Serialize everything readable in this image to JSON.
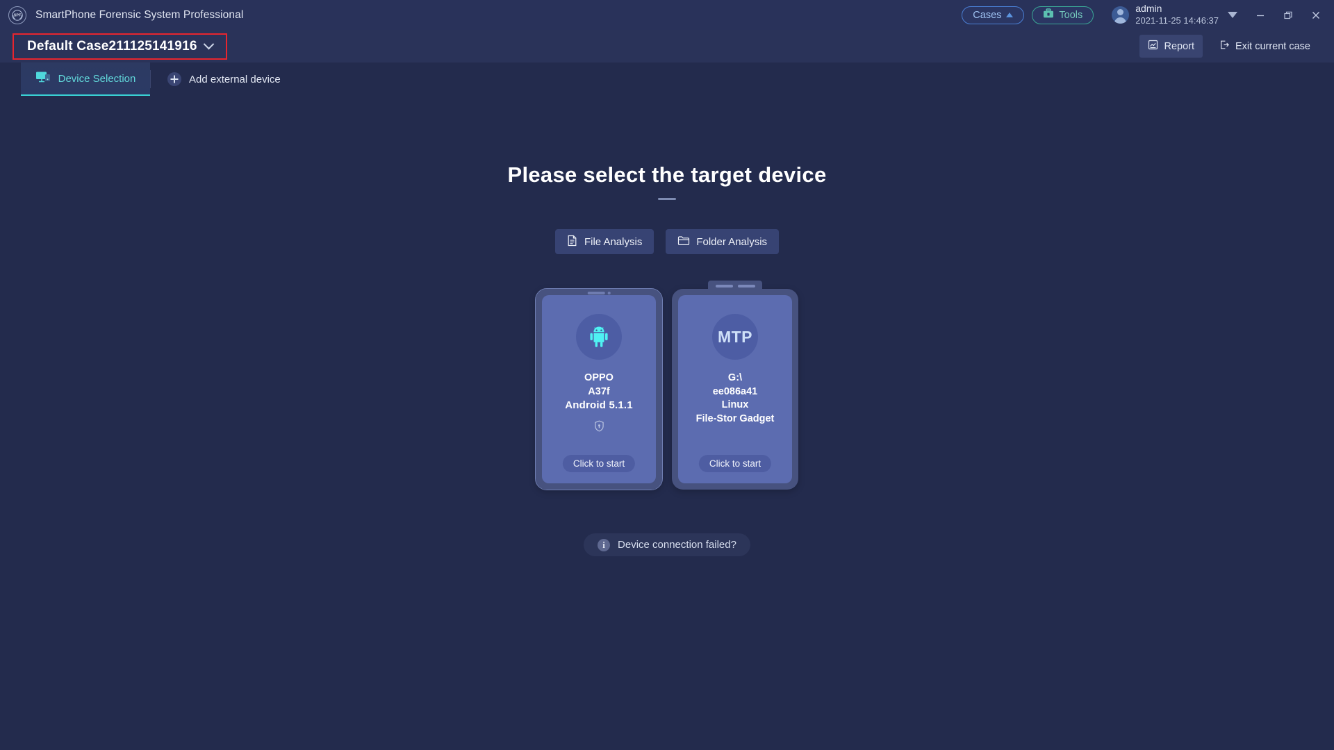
{
  "titlebar": {
    "logo_icon": "spf-emblem-icon",
    "app_title": "SmartPhone Forensic System Professional",
    "cases_label": "Cases",
    "cases_caret_icon": "caret-up-icon",
    "tools_label": "Tools",
    "tools_icon": "toolbox-icon",
    "avatar_icon": "user-avatar-icon",
    "user_name": "admin",
    "datetime": "2021-11-25 14:46:37",
    "window_controls": {
      "dropdown_icon": "caret-down-icon",
      "minimize_label": "—",
      "restore_label": "❐",
      "close_label": "✕"
    }
  },
  "casebar": {
    "case_name": "Default Case211125141916",
    "chevron_icon": "chevron-down-icon",
    "highlight_color": "#e8252e",
    "report_label": "Report",
    "report_icon": "report-icon",
    "exit_label": "Exit current case",
    "exit_icon": "exit-icon"
  },
  "tabs": {
    "device_selection_label": "Device Selection",
    "device_selection_icon": "monitor-icon",
    "active_accent": "#39d3d6",
    "add_external_label": "Add external device",
    "add_external_icon": "plus-circle-icon"
  },
  "main": {
    "headline": "Please select the target device",
    "file_analysis_label": "File Analysis",
    "file_analysis_icon": "file-document-icon",
    "folder_analysis_label": "Folder Analysis",
    "folder_analysis_icon": "folder-icon",
    "failed_label": "Device connection failed?",
    "failed_icon": "info-icon"
  },
  "devices": [
    {
      "type": "android-phone",
      "badge_icon": "android-robot-icon",
      "badge_text": "",
      "lines": [
        "OPPO",
        "A37f",
        "Android 5.1.1"
      ],
      "lock_icon": "shield-lock-icon",
      "start_label": "Click to start"
    },
    {
      "type": "mtp-storage",
      "badge_icon": "mtp-text-icon",
      "badge_text": "MTP",
      "lines": [
        "G:\\",
        "ee086a41",
        "Linux",
        "File-Stor Gadget"
      ],
      "lock_icon": "",
      "start_label": "Click to start"
    }
  ]
}
